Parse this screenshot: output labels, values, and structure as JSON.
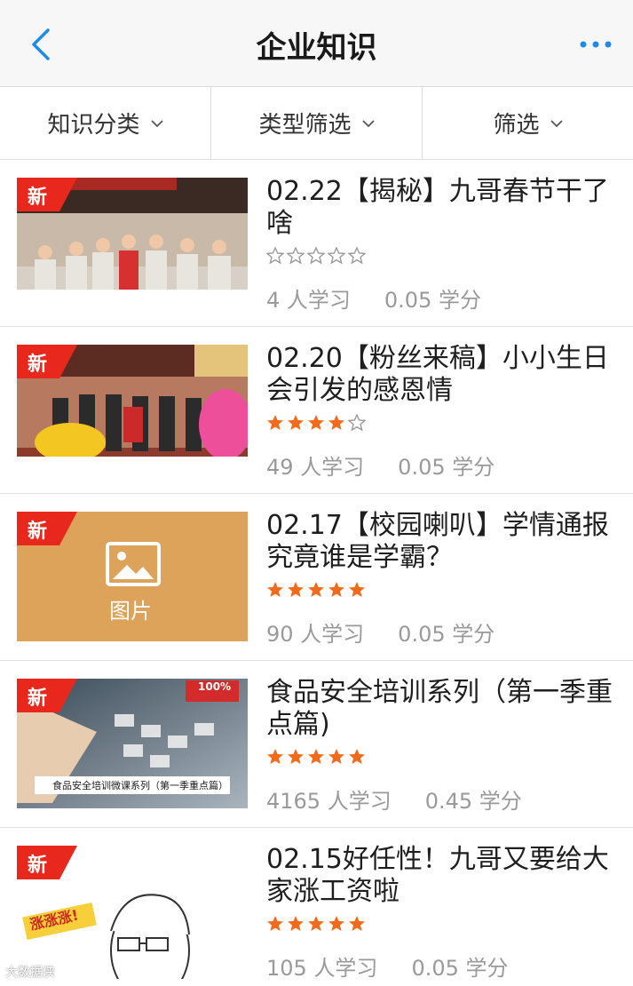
{
  "header": {
    "title": "企业知识",
    "back_icon": "chevron-left-icon",
    "more_icon": "more-dots-icon",
    "accent_color": "#1e8be6"
  },
  "filters": [
    {
      "label": "知识分类",
      "icon": "chevron-down-icon"
    },
    {
      "label": "类型筛选",
      "icon": "chevron-down-icon"
    },
    {
      "label": "筛选",
      "icon": "chevron-down-icon"
    }
  ],
  "badge_text": "新",
  "badge_color": "#e8281c",
  "star_color": "#f26a1b",
  "items": [
    {
      "title": "02.22【揭秘】九哥春节干了啥",
      "rating": 0,
      "learners": "4 人学习",
      "credits": "0.05 学分",
      "thumb": "group-photo-staff"
    },
    {
      "title": "02.20【粉丝来稿】小小生日会引发的感恩情",
      "rating": 4,
      "learners": "49 人学习",
      "credits": "0.05 学分",
      "thumb": "lion-dance-photo"
    },
    {
      "title": "02.17【校园喇叭】学情通报 究竟谁是学霸？",
      "rating": 5,
      "learners": "90 人学习",
      "credits": "0.05 学分",
      "thumb": "image-placeholder",
      "placeholder_label": "图片"
    },
    {
      "title": "食品安全培训系列（第一季重点篇)",
      "rating": 5,
      "learners": "4165 人学习",
      "credits": "0.45 学分",
      "thumb": "food-safety-video",
      "thumb_caption": "食品安全培训微课系列（第一季重点篇）",
      "thumb_tag": "100%"
    },
    {
      "title": "02.15好任性！九哥又要给大家涨工资啦",
      "rating": 5,
      "learners": "105 人学习",
      "credits": "0.05 学分",
      "thumb": "cartoon-face",
      "thumb_caption": "涨涨涨!"
    }
  ],
  "watermark": "大数据侠"
}
